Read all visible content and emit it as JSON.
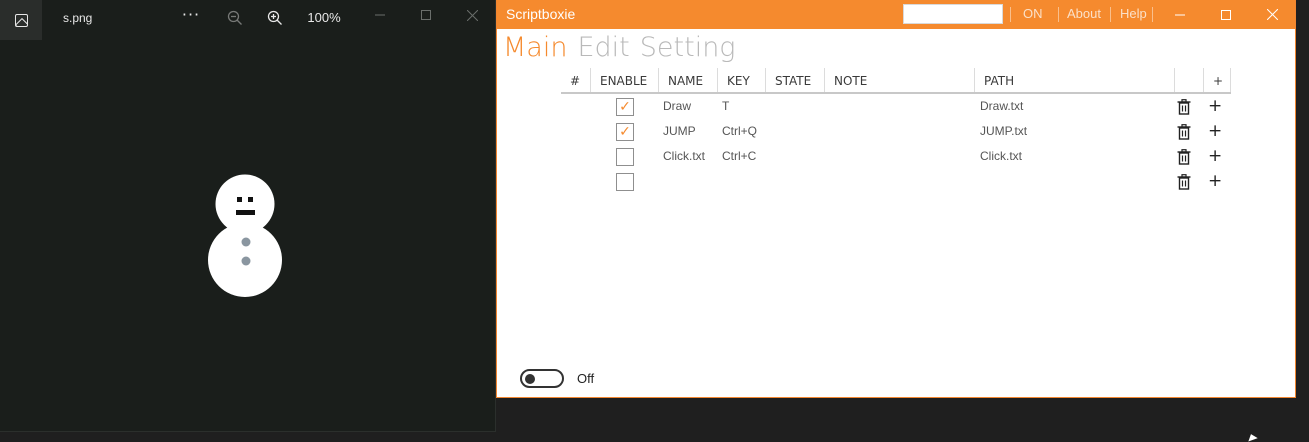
{
  "viewer": {
    "filename": "s.png",
    "more_label": "···",
    "zoom_level": "100%"
  },
  "scriptboxie": {
    "title": "Scriptboxie",
    "search_value": "",
    "status_label": "ON",
    "about_label": "About",
    "help_label": "Help",
    "tabs": [
      {
        "label": "Main",
        "active": true
      },
      {
        "label": "Edit",
        "active": false
      },
      {
        "label": "Setting",
        "active": false
      }
    ],
    "columns": [
      "#",
      "ENABLE",
      "NAME",
      "KEY",
      "STATE",
      "NOTE",
      "PATH",
      "",
      "+"
    ],
    "rows": [
      {
        "enabled": true,
        "name": "Draw",
        "key": "T",
        "state": "",
        "note": "",
        "path": "Draw.txt"
      },
      {
        "enabled": true,
        "name": "JUMP",
        "key": "Ctrl+Q",
        "state": "",
        "note": "",
        "path": "JUMP.txt"
      },
      {
        "enabled": false,
        "name": "Click.txt",
        "key": "Ctrl+C",
        "state": "",
        "note": "",
        "path": "Click.txt"
      },
      {
        "enabled": false,
        "name": "",
        "key": "",
        "state": "",
        "note": "",
        "path": ""
      }
    ],
    "toggle_label": "Off",
    "accent_color": "#f58a2e"
  }
}
